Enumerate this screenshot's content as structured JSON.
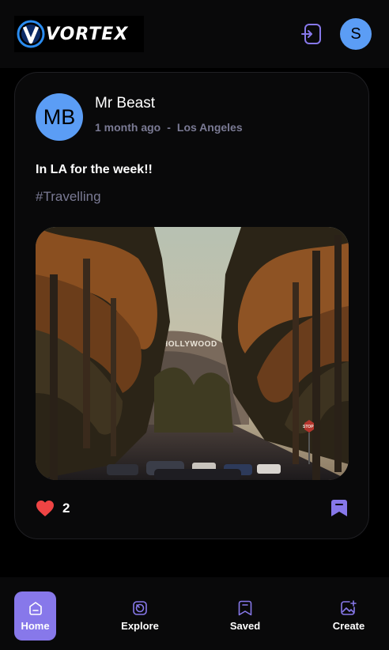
{
  "app": {
    "logo_text": "VORTEX",
    "user_initial": "S",
    "accent_color": "#8778ea",
    "avatar_color": "#5b9df5"
  },
  "post": {
    "author_initials": "MB",
    "author_name": "Mr Beast",
    "time_ago": "1 month ago",
    "separator": "-",
    "location": "Los Angeles",
    "caption": "In LA for the week!!",
    "tags": "#Travelling",
    "likes": "2",
    "image_sign_text": "HOLLYWOOD",
    "image_stop_sign_text": "STOP"
  },
  "nav": {
    "items": [
      {
        "label": "Home",
        "icon": "home-icon",
        "active": true
      },
      {
        "label": "Explore",
        "icon": "explore-icon",
        "active": false
      },
      {
        "label": "Saved",
        "icon": "bookmark-icon",
        "active": false
      },
      {
        "label": "Create",
        "icon": "create-image-icon",
        "active": false
      }
    ]
  }
}
